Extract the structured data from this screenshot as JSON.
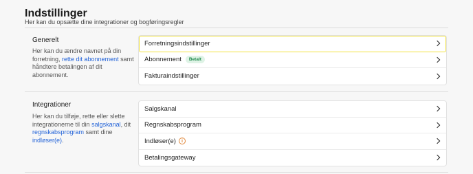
{
  "header": {
    "title": "Indstillinger",
    "subtitle": "Her kan du opsætte dine integrationer og bogføringsregler"
  },
  "sections": [
    {
      "title": "Generelt",
      "desc_before": "Her kan du ændre navnet på din forretning, ",
      "desc_link1": "rette dit abonnement",
      "desc_after": " samt håndtere betalingen af dit abonnement.",
      "rows": [
        {
          "label": "Forretningsindstillinger"
        },
        {
          "label": "Abonnement",
          "badge": "Betalt"
        },
        {
          "label": "Fakturaindstillinger"
        }
      ]
    },
    {
      "title": "Integrationer",
      "desc_before": "Her kan du tilføje, rette eller slette integrationerne til din ",
      "desc_link1": "salgskanal",
      "desc_mid1": ", dit ",
      "desc_link2": "regnskabsprogram",
      "desc_mid2": " samt dine ",
      "desc_link3": "indløser(e)",
      "desc_after": ".",
      "rows": [
        {
          "label": "Salgskanal"
        },
        {
          "label": "Regnskabsprogram"
        },
        {
          "label": "Indløser(e)",
          "icon": "info-icon",
          "icon_glyph": "i"
        },
        {
          "label": "Betalingsgateway"
        }
      ]
    }
  ],
  "colors": {
    "link": "#2464d8",
    "highlight_border": "#f2e33c",
    "badge_text": "#1f8a4c",
    "badge_bg": "#dff3e6",
    "info_icon": "#e0873a"
  }
}
